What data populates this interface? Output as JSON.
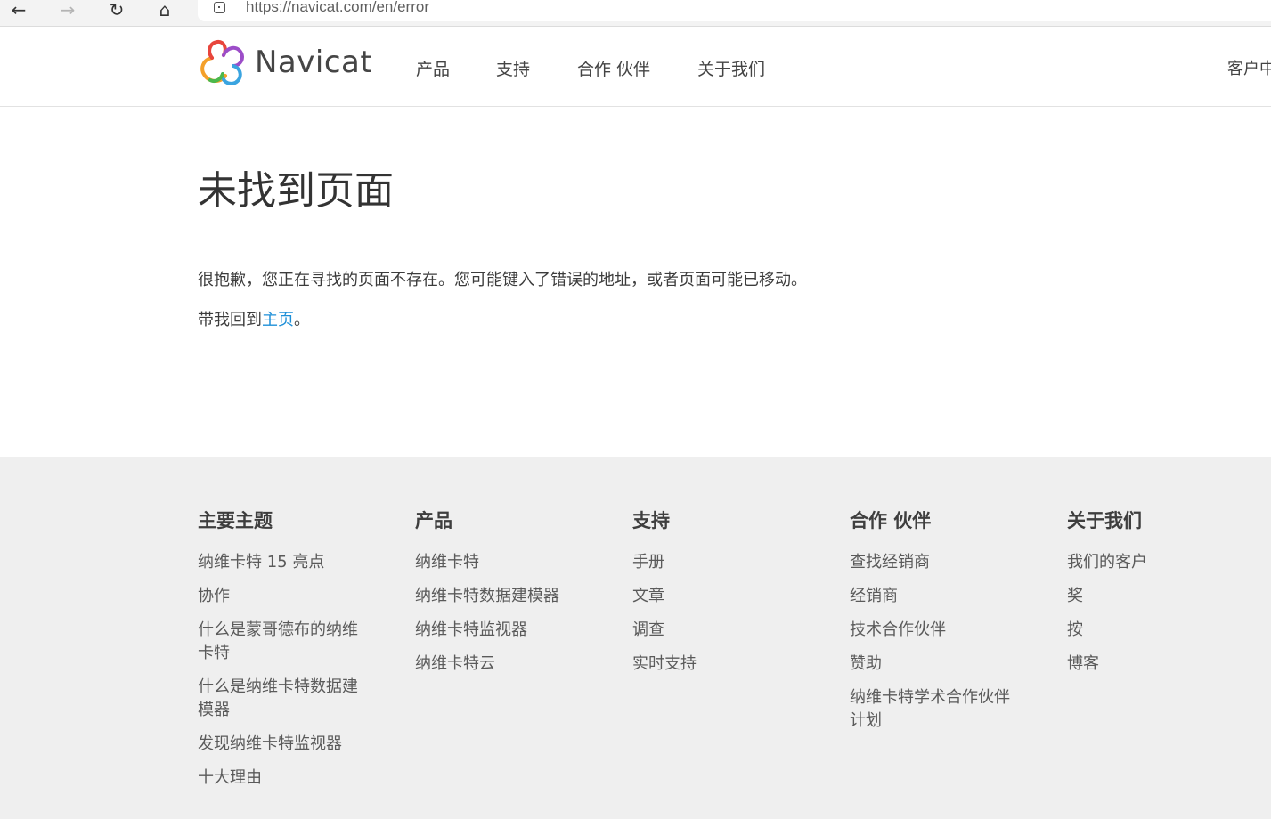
{
  "browser": {
    "url": "https://navicat.com/en/error",
    "back_glyph": "←",
    "forward_glyph": "→",
    "reload_glyph": "↻",
    "home_glyph": "⌂"
  },
  "header": {
    "logo_text": "Navicat",
    "nav": [
      {
        "label": "产品"
      },
      {
        "label": "支持"
      },
      {
        "label": "合作 伙伴"
      },
      {
        "label": "关于我们"
      }
    ],
    "customer_link": "客户中"
  },
  "main": {
    "title": "未找到页面",
    "message": "很抱歉，您正在寻找的页面不存在。您可能键入了错误的地址，或者页面可能已移动。",
    "back_prefix": "带我回到",
    "back_link": "主页",
    "back_suffix": "。"
  },
  "footer": {
    "columns": [
      {
        "heading": "主要主题",
        "links": [
          "纳维卡特 15 亮点",
          "协作",
          "什么是蒙哥德布的纳维卡特",
          "什么是纳维卡特数据建模器",
          "发现纳维卡特监视器",
          "十大理由"
        ]
      },
      {
        "heading": "产品",
        "links": [
          "纳维卡特",
          "纳维卡特数据建模器",
          "纳维卡特监视器",
          "纳维卡特云"
        ]
      },
      {
        "heading": "支持",
        "links": [
          "手册",
          "文章",
          "调查",
          "实时支持"
        ]
      },
      {
        "heading": "合作 伙伴",
        "links": [
          "查找经销商",
          "经销商",
          "技术合作伙伴",
          "赞助",
          "纳维卡特学术合作伙伴计划"
        ]
      },
      {
        "heading": "关于我们",
        "links": [
          "我们的客户",
          "奖",
          "按",
          "博客"
        ]
      }
    ]
  },
  "colors": {
    "link_blue": "#1d8fd8",
    "footer_bg": "#efefef"
  }
}
